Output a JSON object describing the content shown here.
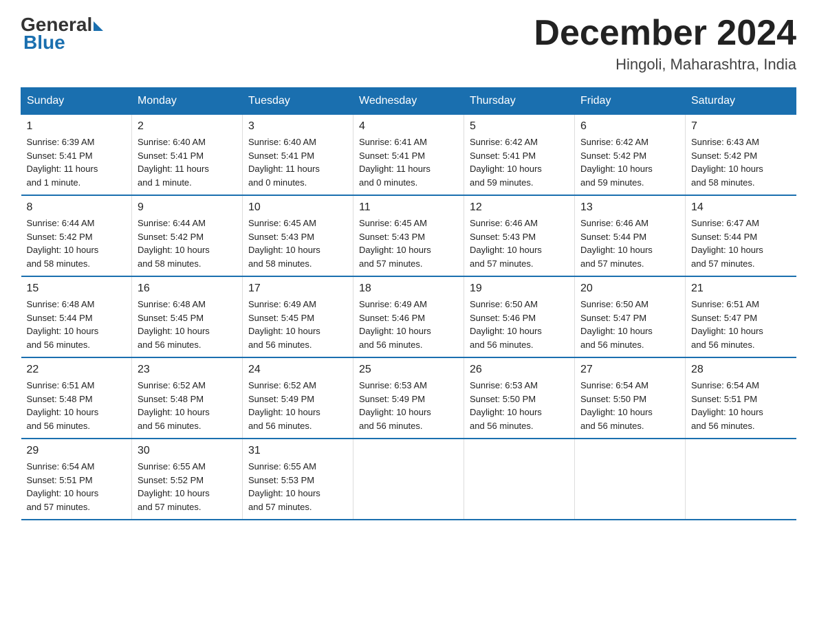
{
  "logo": {
    "general": "General",
    "blue": "Blue",
    "tagline": "Blue"
  },
  "header": {
    "month_year": "December 2024",
    "location": "Hingoli, Maharashtra, India"
  },
  "days_of_week": [
    "Sunday",
    "Monday",
    "Tuesday",
    "Wednesday",
    "Thursday",
    "Friday",
    "Saturday"
  ],
  "weeks": [
    [
      {
        "day": "1",
        "sunrise": "6:39 AM",
        "sunset": "5:41 PM",
        "daylight": "11 hours and 1 minute."
      },
      {
        "day": "2",
        "sunrise": "6:40 AM",
        "sunset": "5:41 PM",
        "daylight": "11 hours and 1 minute."
      },
      {
        "day": "3",
        "sunrise": "6:40 AM",
        "sunset": "5:41 PM",
        "daylight": "11 hours and 0 minutes."
      },
      {
        "day": "4",
        "sunrise": "6:41 AM",
        "sunset": "5:41 PM",
        "daylight": "11 hours and 0 minutes."
      },
      {
        "day": "5",
        "sunrise": "6:42 AM",
        "sunset": "5:41 PM",
        "daylight": "10 hours and 59 minutes."
      },
      {
        "day": "6",
        "sunrise": "6:42 AM",
        "sunset": "5:42 PM",
        "daylight": "10 hours and 59 minutes."
      },
      {
        "day": "7",
        "sunrise": "6:43 AM",
        "sunset": "5:42 PM",
        "daylight": "10 hours and 58 minutes."
      }
    ],
    [
      {
        "day": "8",
        "sunrise": "6:44 AM",
        "sunset": "5:42 PM",
        "daylight": "10 hours and 58 minutes."
      },
      {
        "day": "9",
        "sunrise": "6:44 AM",
        "sunset": "5:42 PM",
        "daylight": "10 hours and 58 minutes."
      },
      {
        "day": "10",
        "sunrise": "6:45 AM",
        "sunset": "5:43 PM",
        "daylight": "10 hours and 58 minutes."
      },
      {
        "day": "11",
        "sunrise": "6:45 AM",
        "sunset": "5:43 PM",
        "daylight": "10 hours and 57 minutes."
      },
      {
        "day": "12",
        "sunrise": "6:46 AM",
        "sunset": "5:43 PM",
        "daylight": "10 hours and 57 minutes."
      },
      {
        "day": "13",
        "sunrise": "6:46 AM",
        "sunset": "5:44 PM",
        "daylight": "10 hours and 57 minutes."
      },
      {
        "day": "14",
        "sunrise": "6:47 AM",
        "sunset": "5:44 PM",
        "daylight": "10 hours and 57 minutes."
      }
    ],
    [
      {
        "day": "15",
        "sunrise": "6:48 AM",
        "sunset": "5:44 PM",
        "daylight": "10 hours and 56 minutes."
      },
      {
        "day": "16",
        "sunrise": "6:48 AM",
        "sunset": "5:45 PM",
        "daylight": "10 hours and 56 minutes."
      },
      {
        "day": "17",
        "sunrise": "6:49 AM",
        "sunset": "5:45 PM",
        "daylight": "10 hours and 56 minutes."
      },
      {
        "day": "18",
        "sunrise": "6:49 AM",
        "sunset": "5:46 PM",
        "daylight": "10 hours and 56 minutes."
      },
      {
        "day": "19",
        "sunrise": "6:50 AM",
        "sunset": "5:46 PM",
        "daylight": "10 hours and 56 minutes."
      },
      {
        "day": "20",
        "sunrise": "6:50 AM",
        "sunset": "5:47 PM",
        "daylight": "10 hours and 56 minutes."
      },
      {
        "day": "21",
        "sunrise": "6:51 AM",
        "sunset": "5:47 PM",
        "daylight": "10 hours and 56 minutes."
      }
    ],
    [
      {
        "day": "22",
        "sunrise": "6:51 AM",
        "sunset": "5:48 PM",
        "daylight": "10 hours and 56 minutes."
      },
      {
        "day": "23",
        "sunrise": "6:52 AM",
        "sunset": "5:48 PM",
        "daylight": "10 hours and 56 minutes."
      },
      {
        "day": "24",
        "sunrise": "6:52 AM",
        "sunset": "5:49 PM",
        "daylight": "10 hours and 56 minutes."
      },
      {
        "day": "25",
        "sunrise": "6:53 AM",
        "sunset": "5:49 PM",
        "daylight": "10 hours and 56 minutes."
      },
      {
        "day": "26",
        "sunrise": "6:53 AM",
        "sunset": "5:50 PM",
        "daylight": "10 hours and 56 minutes."
      },
      {
        "day": "27",
        "sunrise": "6:54 AM",
        "sunset": "5:50 PM",
        "daylight": "10 hours and 56 minutes."
      },
      {
        "day": "28",
        "sunrise": "6:54 AM",
        "sunset": "5:51 PM",
        "daylight": "10 hours and 56 minutes."
      }
    ],
    [
      {
        "day": "29",
        "sunrise": "6:54 AM",
        "sunset": "5:51 PM",
        "daylight": "10 hours and 57 minutes."
      },
      {
        "day": "30",
        "sunrise": "6:55 AM",
        "sunset": "5:52 PM",
        "daylight": "10 hours and 57 minutes."
      },
      {
        "day": "31",
        "sunrise": "6:55 AM",
        "sunset": "5:53 PM",
        "daylight": "10 hours and 57 minutes."
      },
      null,
      null,
      null,
      null
    ]
  ],
  "labels": {
    "sunrise": "Sunrise:",
    "sunset": "Sunset:",
    "daylight": "Daylight:"
  }
}
